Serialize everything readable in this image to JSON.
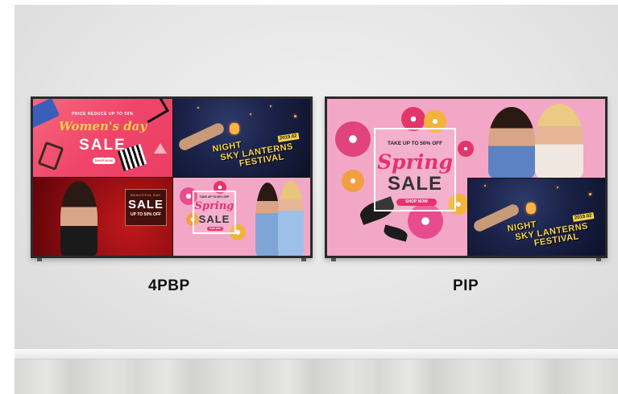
{
  "captions": {
    "left": "4PBP",
    "right": "PIP"
  },
  "womens_day": {
    "tagline": "PRICE REDUCE UP TO 50%",
    "script": "Women's day",
    "sale": "SALE",
    "button": "SHOP NOW"
  },
  "lantern": {
    "title_line1": "NIGHT",
    "title_line2": "SKY LANTERNS",
    "title_line3": "FESTIVAL",
    "date": "2019.02"
  },
  "red_sale": {
    "small": "BEAUTIFUL DAY",
    "sale": "SALE",
    "offer": "UP TO 50% OFF"
  },
  "spring": {
    "take": "TAKE UP TO 50% OFF",
    "script": "Spring",
    "sale": "SALE",
    "button": "SHOP NOW"
  },
  "colors": {
    "pink_bg": "#f3a7c6",
    "accent_pink": "#e8316d",
    "lantern_gold": "#f6d34a",
    "bezel": "#2a2a2d"
  }
}
